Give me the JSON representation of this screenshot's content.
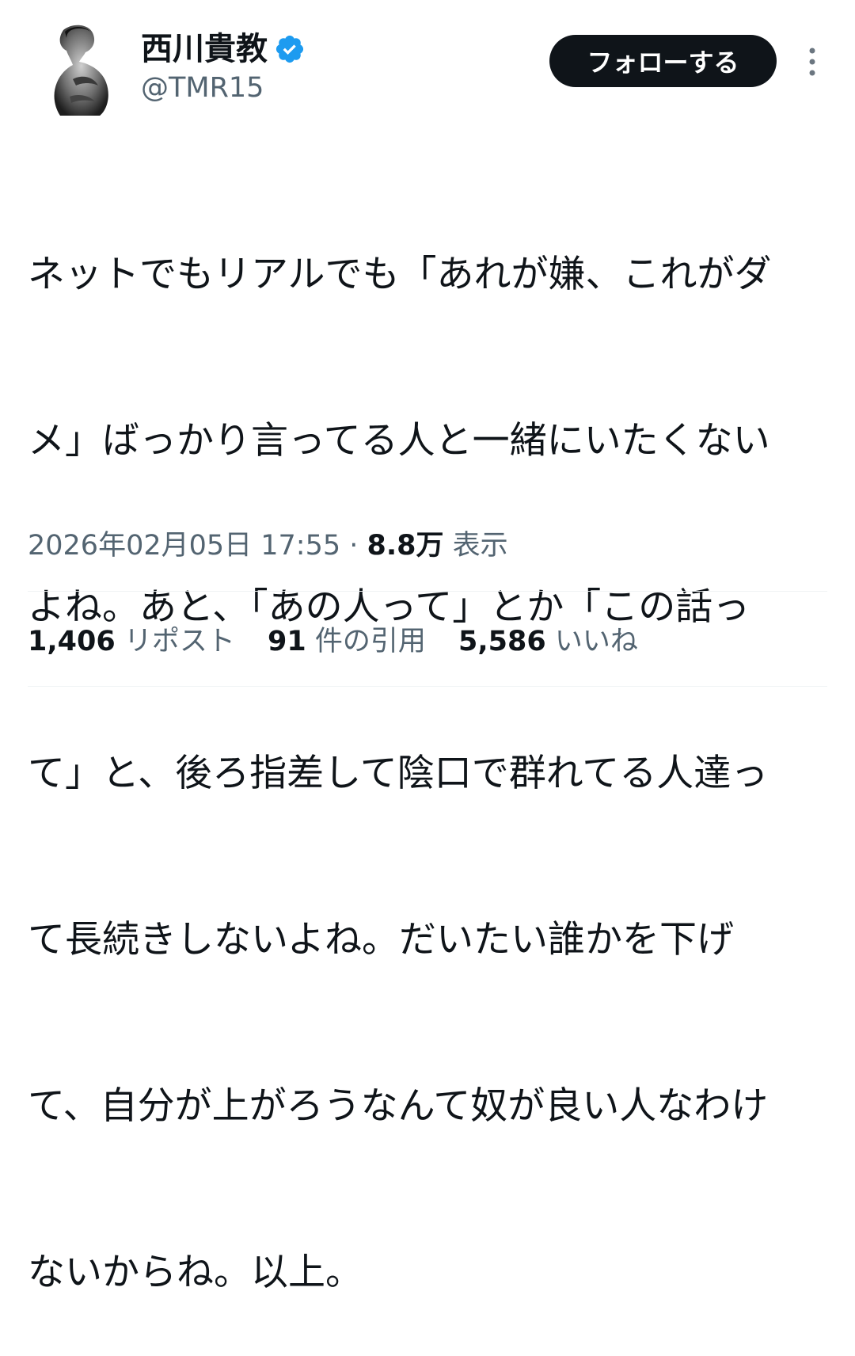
{
  "author": {
    "display_name": "西川貴教",
    "handle": "@TMR15",
    "verified_color": "#1d9bf0"
  },
  "follow_button": {
    "label": "フォローする"
  },
  "tweet": {
    "text_lines": [
      "ネットでもリアルでも「あれが嫌、これがダ",
      "メ」ばっかり言ってる人と一緒にいたくない",
      "よね。あと、「あの人って」とか「この話っ",
      "て」と、後ろ指差して陰口で群れてる人達っ",
      "て長続きしないよね。だいたい誰かを下げ",
      "て、自分が上がろうなんて奴が良い人なわけ",
      "ないからね。以上。"
    ]
  },
  "meta": {
    "timestamp": "2026年02月05日 17:55",
    "separator": " · ",
    "views_count": "8.8万",
    "views_label": " 表示"
  },
  "stats": {
    "reposts": {
      "count": "1,406",
      "label": " リポスト"
    },
    "quotes": {
      "count": "91",
      "label": " 件の引用"
    },
    "likes": {
      "count": "5,586",
      "label": " いいね"
    }
  },
  "icons": {
    "verified": "verified-badge-icon",
    "more": "more-vertical-icon"
  },
  "colors": {
    "text_primary": "#0f1419",
    "text_secondary": "#536471",
    "follow_bg": "#0f1419",
    "divider": "#eff3f4"
  }
}
